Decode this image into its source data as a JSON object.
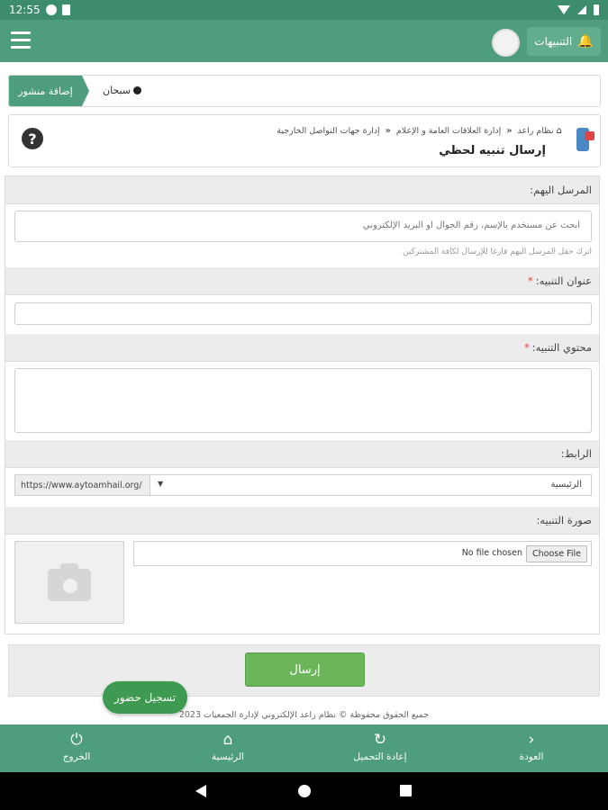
{
  "status": {
    "time": "12:55"
  },
  "header": {
    "notifications_label": "التنبيهات"
  },
  "ticker": {
    "add_post_label": "إضافة منشور",
    "text": "سبحان"
  },
  "breadcrumb": {
    "items": [
      "نظام راعد",
      "إدارة العلاقات العامة و الإعلام",
      "إدارة جهات التواصل الخارجية"
    ],
    "page_title": "إرسال تنبيه لحظي"
  },
  "form": {
    "recipients": {
      "label": "المرسل اليهم:",
      "placeholder": "ابحث عن مستخدم بالإسم، رقم الجوال او البريد الإلكتروني",
      "hint": "اترك حقل المرسل اليهم فارغا للإرسال لكافة المشتركين"
    },
    "title": {
      "label": "عنوان التنبيه:",
      "required_mark": "*",
      "value": ""
    },
    "content": {
      "label": "محتوي التنبيه:",
      "required_mark": "*",
      "value": ""
    },
    "link": {
      "label": "الرابط:",
      "prefix": "https://www.aytoamhail.org/",
      "selected": "الرئيسية"
    },
    "image": {
      "label": "صورة التنبيه:",
      "choose_label": "Choose File",
      "no_file": "No file chosen"
    },
    "submit_label": "إرسال"
  },
  "attendance_label": "تسجيل حضور",
  "copyright": "جميع الحقوق محفوظة © نظام راعد الإلكتروني لإدارة الجمعيات 2023",
  "bottom_nav": [
    {
      "label": "الخروج",
      "icon": "power-icon"
    },
    {
      "label": "الرئيسية",
      "icon": "home-icon"
    },
    {
      "label": "إعادة التحميل",
      "icon": "reload-icon"
    },
    {
      "label": "العودة",
      "icon": "chevron-right-icon"
    }
  ],
  "colors": {
    "primary": "#4e9e7e",
    "submit": "#6db55a",
    "attendance": "#3d9a50",
    "required": "#e04444"
  }
}
